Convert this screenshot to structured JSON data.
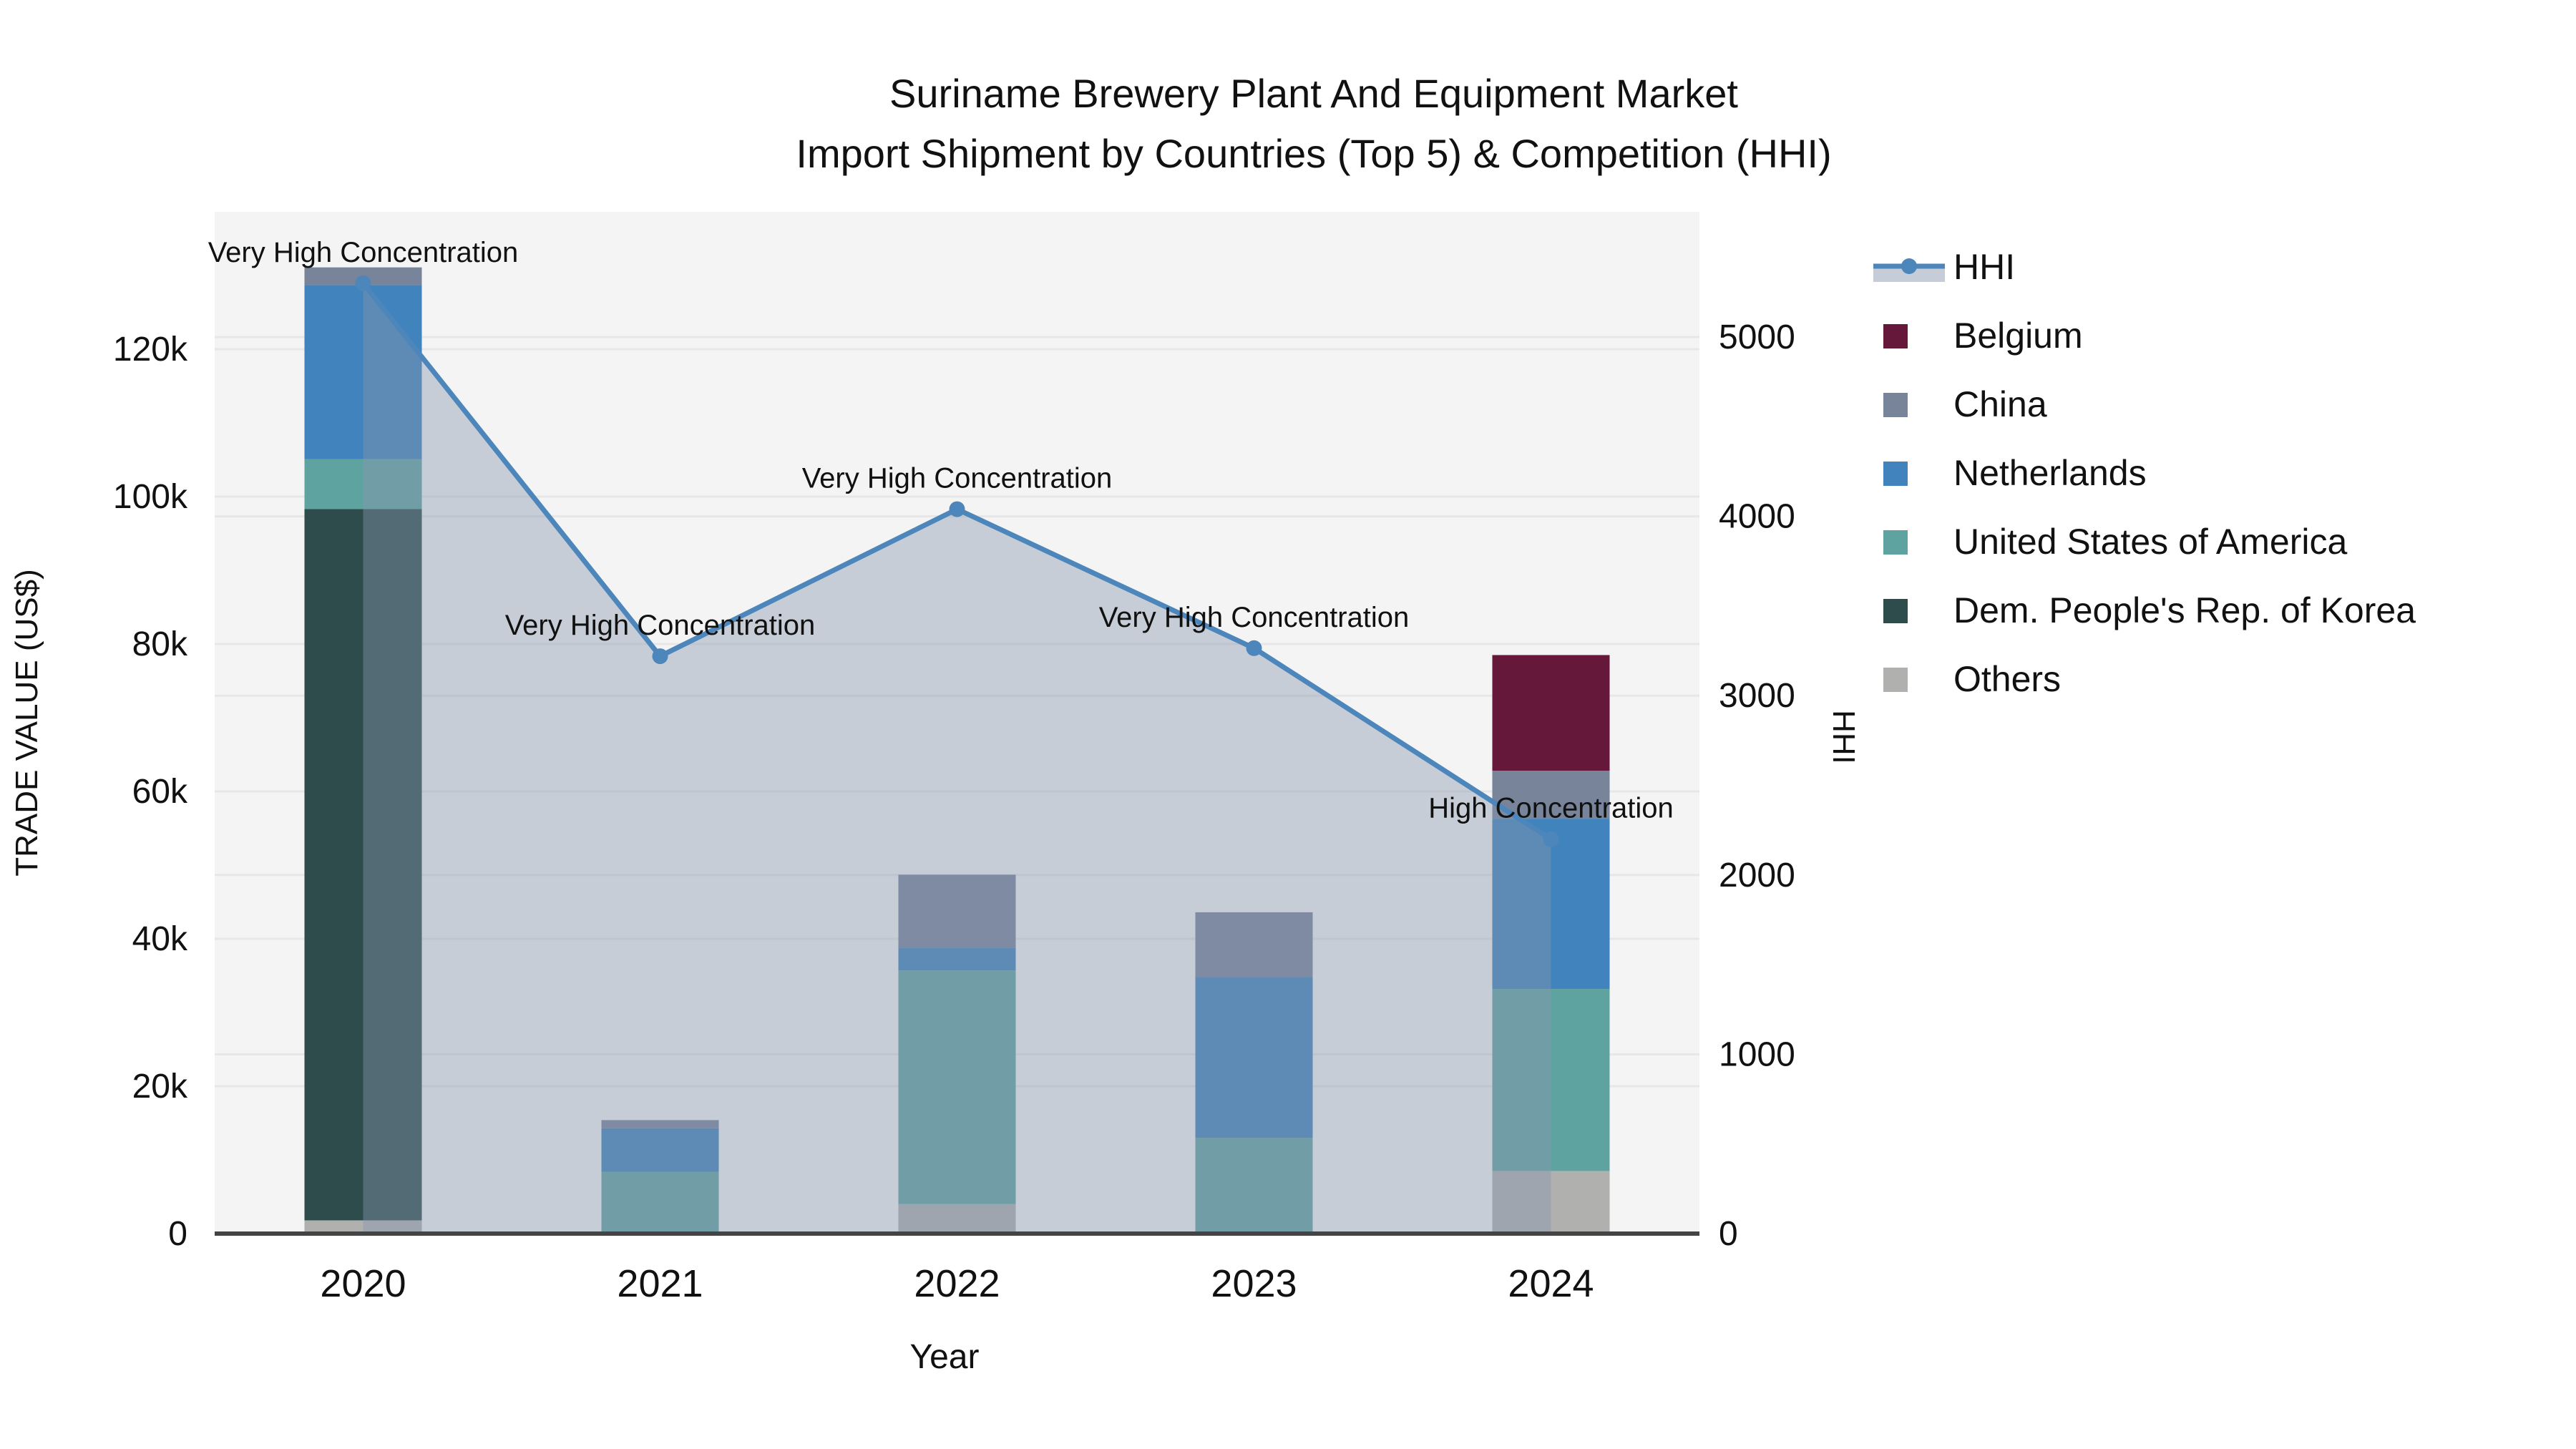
{
  "title": {
    "line1": "Suriname Brewery Plant And Equipment Market",
    "line2": "Import Shipment by Countries (Top 5) & Competition (HHI)"
  },
  "axes": {
    "left_title": "TRADE VALUE (US$)",
    "right_title": "HHI",
    "x_title": "Year",
    "left_ticks": [
      {
        "value": 0,
        "label": "0"
      },
      {
        "value": 20000,
        "label": "20k"
      },
      {
        "value": 40000,
        "label": "40k"
      },
      {
        "value": 60000,
        "label": "60k"
      },
      {
        "value": 80000,
        "label": "80k"
      },
      {
        "value": 100000,
        "label": "100k"
      },
      {
        "value": 120000,
        "label": "120k"
      }
    ],
    "right_ticks": [
      {
        "value": 0,
        "label": "0"
      },
      {
        "value": 1000,
        "label": "1000"
      },
      {
        "value": 2000,
        "label": "2000"
      },
      {
        "value": 3000,
        "label": "3000"
      },
      {
        "value": 4000,
        "label": "4000"
      },
      {
        "value": 5000,
        "label": "5000"
      }
    ]
  },
  "legend": {
    "items": [
      {
        "label": "HHI",
        "type": "line",
        "color": "#4C86BA"
      },
      {
        "label": "Belgium",
        "type": "swatch",
        "color": "#65183A"
      },
      {
        "label": "China",
        "type": "swatch",
        "color": "#778499"
      },
      {
        "label": "Netherlands",
        "type": "swatch",
        "color": "#4183BC"
      },
      {
        "label": "United States of America",
        "type": "swatch",
        "color": "#5FA3A0"
      },
      {
        "label": "Dem. People's Rep. of Korea",
        "type": "swatch",
        "color": "#2E4C4B"
      },
      {
        "label": "Others",
        "type": "swatch",
        "color": "#B0B0AE"
      }
    ]
  },
  "chart_data": {
    "type": "bar+line",
    "title": "Suriname Brewery Plant And Equipment Market Import Shipment by Countries (Top 5) & Competition (HHI)",
    "xlabel": "Year",
    "ylabel_left": "TRADE VALUE (US$)",
    "ylabel_right": "HHI",
    "ylim_left": [
      0,
      138000
    ],
    "ylim_right": [
      0,
      5700
    ],
    "grid": true,
    "legend_position": "right",
    "categories": [
      "2020",
      "2021",
      "2022",
      "2023",
      "2024"
    ],
    "series": [
      {
        "name": "Belgium",
        "color": "#65183A",
        "values": [
          0,
          0,
          0,
          0,
          15700
        ]
      },
      {
        "name": "China",
        "color": "#778499",
        "values": [
          2400,
          1100,
          9900,
          8800,
          6500
        ]
      },
      {
        "name": "Netherlands",
        "color": "#4183BC",
        "values": [
          23600,
          5900,
          3100,
          21800,
          23100
        ]
      },
      {
        "name": "United States of America",
        "color": "#5FA3A0",
        "values": [
          6800,
          8400,
          31700,
          13000,
          24700
        ]
      },
      {
        "name": "Dem. People's Rep. of Korea",
        "color": "#2E4C4B",
        "values": [
          96500,
          0,
          0,
          0,
          0
        ]
      },
      {
        "name": "Others",
        "color": "#B0B0AE",
        "values": [
          1800,
          0,
          4000,
          0,
          8500
        ]
      }
    ],
    "stack_order_bottom_to_top": [
      "Others",
      "Dem. People's Rep. of Korea",
      "United States of America",
      "Netherlands",
      "China",
      "Belgium"
    ],
    "hhi_line": {
      "name": "HHI",
      "color": "#4C86BA",
      "values": [
        5300,
        3220,
        4040,
        3265,
        2200
      ],
      "area_fill_color": "#8796AF",
      "area_fill_opacity": 0.42
    },
    "annotations": [
      {
        "category": "2020",
        "text": "Very High Concentration"
      },
      {
        "category": "2021",
        "text": "Very High Concentration"
      },
      {
        "category": "2022",
        "text": "Very High Concentration"
      },
      {
        "category": "2023",
        "text": "Very High Concentration"
      },
      {
        "category": "2024",
        "text": "High Concentration"
      }
    ]
  },
  "colors": {
    "plot_background": "#F4F4F4",
    "page_background": "#FFFFFF",
    "gridline": "#E7E7E7",
    "axis_line": "#444444",
    "text": "#111111"
  }
}
